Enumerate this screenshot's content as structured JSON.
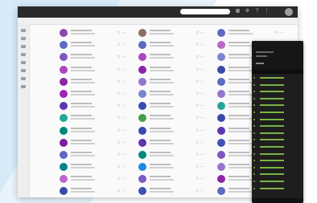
{
  "app": {
    "brand": ""
  },
  "columns": [
    {
      "rows": [
        {
          "color": "#8e44ad"
        },
        {
          "color": "#5c6bc0"
        },
        {
          "color": "#7e57c2"
        },
        {
          "color": "#ab47bc"
        },
        {
          "color": "#8e24aa"
        },
        {
          "color": "#9c27b0"
        },
        {
          "color": "#5e35b1"
        },
        {
          "color": "#26a69a"
        },
        {
          "color": "#00897b"
        },
        {
          "color": "#7b1fa2"
        },
        {
          "color": "#5c6bc0"
        },
        {
          "color": "#00838f"
        },
        {
          "color": "#ba68c8"
        },
        {
          "color": "#3949ab"
        }
      ]
    },
    {
      "rows": [
        {
          "color": "#8d6e63"
        },
        {
          "color": "#5c6bc0"
        },
        {
          "color": "#ab47bc"
        },
        {
          "color": "#8e24aa"
        },
        {
          "color": "#9575cd"
        },
        {
          "color": "#7986cb"
        },
        {
          "color": "#3949ab"
        },
        {
          "color": "#43a047"
        },
        {
          "color": "#3949ab"
        },
        {
          "color": "#5e35b1"
        },
        {
          "color": "#00897b"
        },
        {
          "color": "#1e88e5"
        },
        {
          "color": "#7e57c2"
        },
        {
          "color": "#3f51b5"
        }
      ]
    },
    {
      "rows": [
        {
          "color": "#5c6bc0"
        },
        {
          "color": "#ba68c8"
        },
        {
          "color": "#7986cb"
        },
        {
          "color": "#3949ab"
        },
        {
          "color": "#5c6bc0"
        },
        {
          "color": "#9575cd"
        },
        {
          "color": "#26a69a"
        },
        {
          "color": "#3949ab"
        },
        {
          "color": "#5e35b1"
        },
        {
          "color": "#3f51b5"
        },
        {
          "color": "#7e57c2"
        },
        {
          "color": "#9575cd"
        },
        {
          "color": "#8e24aa"
        },
        {
          "color": "#5c6bc0"
        }
      ]
    }
  ],
  "phone": {
    "items": [
      "",
      "",
      "",
      "",
      "",
      "",
      "",
      "",
      "",
      "",
      "",
      "",
      "",
      "",
      "",
      "",
      ""
    ]
  }
}
